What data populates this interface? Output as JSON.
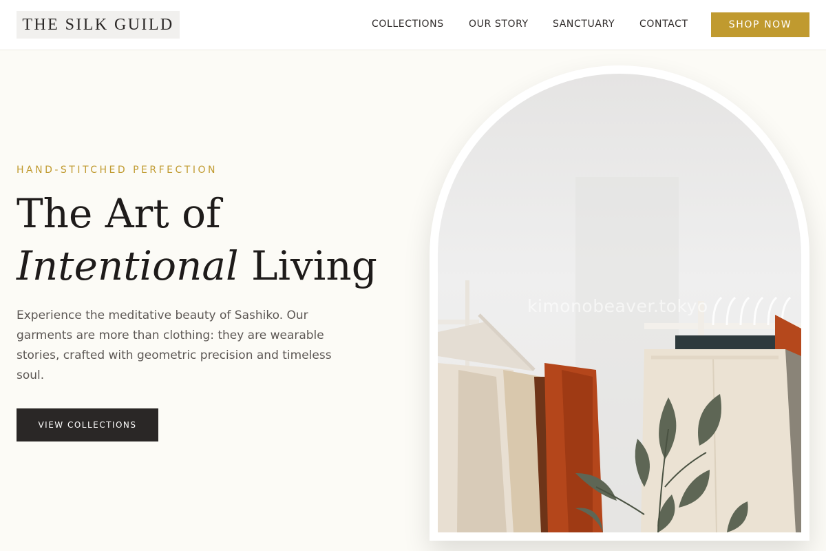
{
  "header": {
    "logo": "THE SILK GUILD",
    "nav": {
      "collections": "COLLECTIONS",
      "our_story": "OUR STORY",
      "sanctuary": "SANCTUARY",
      "contact": "CONTACT"
    },
    "shop_button": "SHOP NOW"
  },
  "hero": {
    "eyebrow": "HAND-STITCHED PERFECTION",
    "headline_line1": "The Art of",
    "headline_italic": "Intentional",
    "headline_rest": " Living",
    "description": "Experience the meditative beauty of Sashiko. Our garments are more than clothing: they are wearable stories, crafted with geometric precision and timeless soul.",
    "cta": "VIEW COLLECTIONS"
  },
  "image": {
    "watermark": "kimonobeaver.tokyo"
  },
  "colors": {
    "accent": "#c09a2f",
    "dark": "#2a2726",
    "background": "#fcfbf6"
  }
}
